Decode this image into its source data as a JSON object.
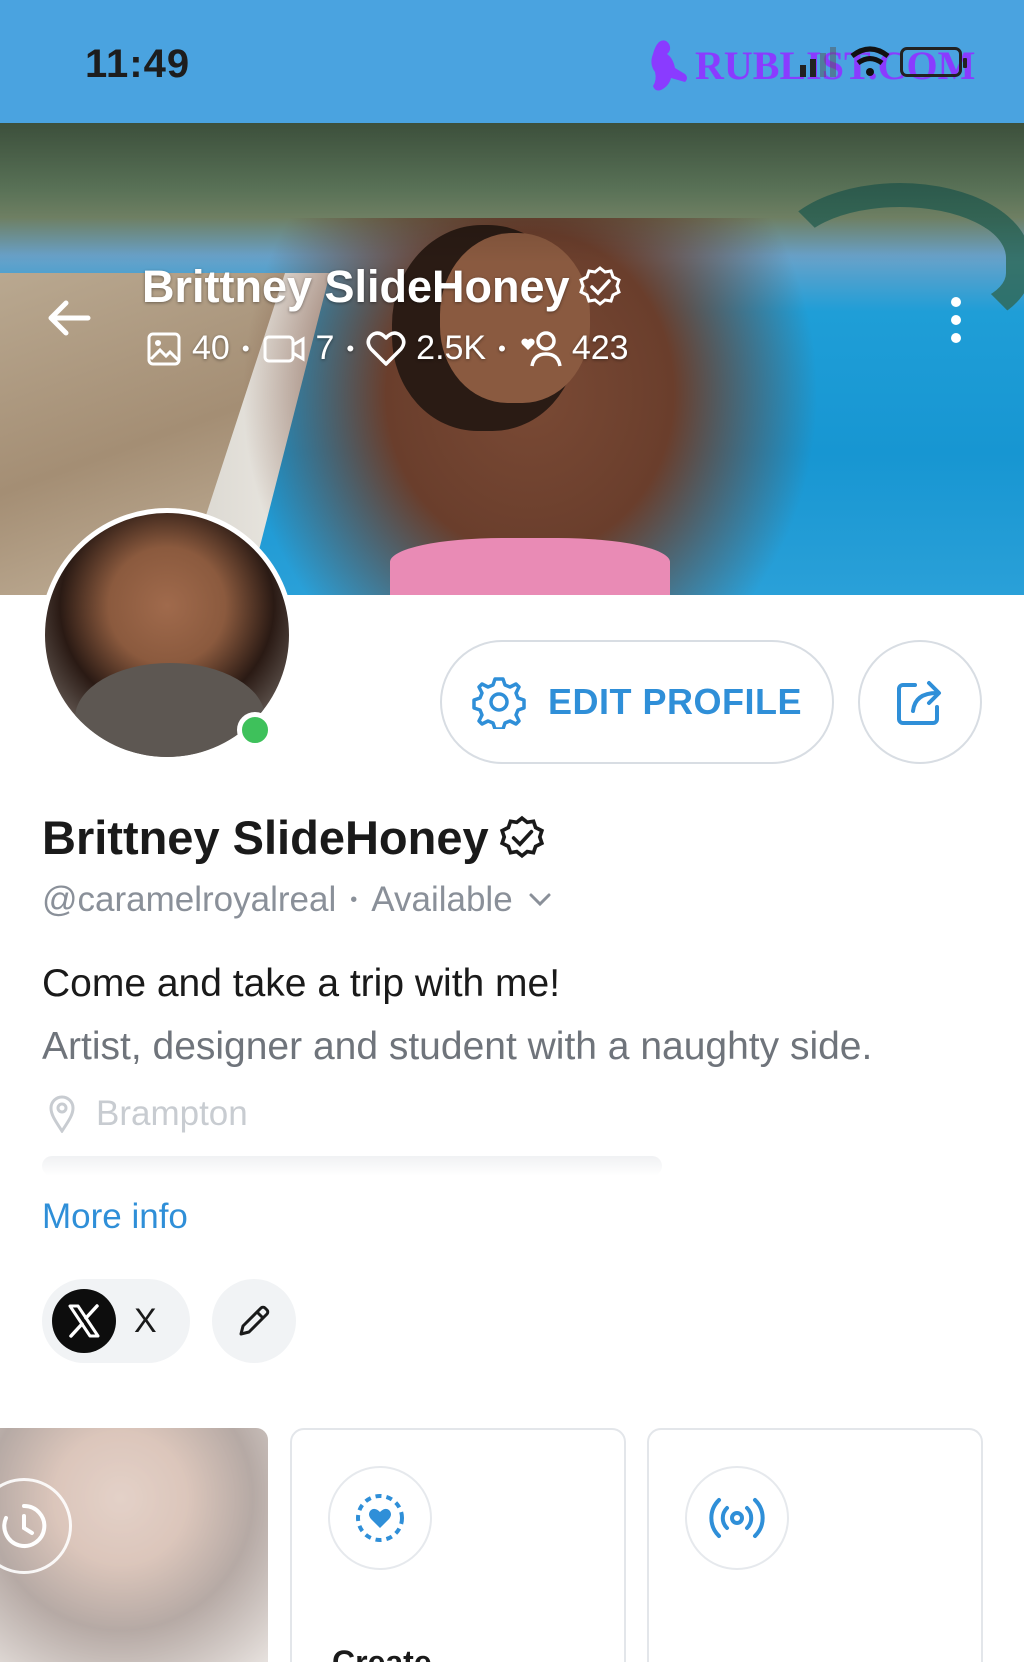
{
  "status_bar": {
    "time": "11:49",
    "watermark": "RUBLIST.COM"
  },
  "cover": {
    "name": "Brittney SlideHoney",
    "stats": {
      "photos": "40",
      "videos": "7",
      "likes": "2.5K",
      "fans": "423"
    }
  },
  "actions": {
    "edit_profile_label": "EDIT PROFILE"
  },
  "profile": {
    "name": "Brittney SlideHoney",
    "handle": "@caramelroyalreal",
    "availability": "Available",
    "bio_line_1": "Come and take a trip with me!",
    "bio_line_2": "Artist, designer and student with a naughty side.",
    "location": "Brampton",
    "more_info_label": "More info"
  },
  "social": {
    "x_label": "X"
  },
  "cards": [
    {
      "label": "Create",
      "icon": "heart-timer-icon"
    },
    {
      "label": "",
      "icon": "live-broadcast-icon"
    }
  ],
  "colors": {
    "status_bar": "#4aa3e0",
    "accent": "#2f8fd8",
    "online": "#3ec15b",
    "watermark": "#8a3bff"
  }
}
